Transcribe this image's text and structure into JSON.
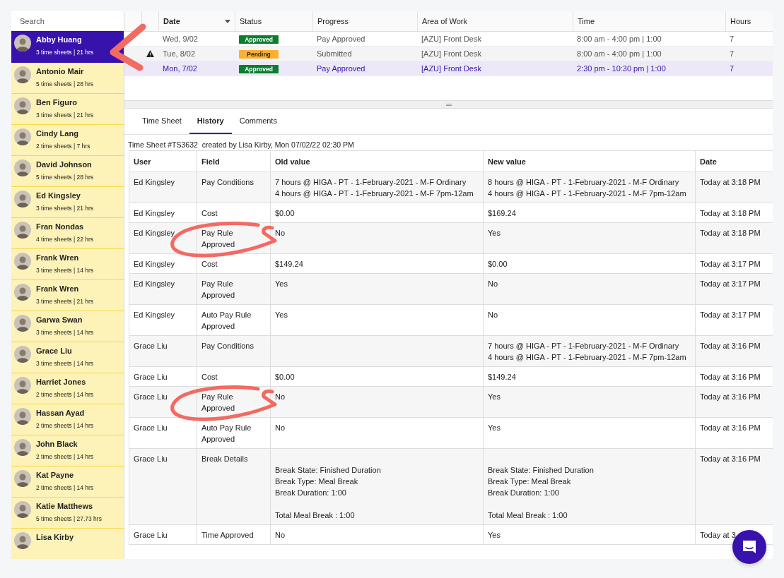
{
  "sidebar": {
    "search": {
      "placeholder": "Search"
    },
    "employees": [
      {
        "name": "Abby Huang",
        "summary": "3 time sheets | 21 hrs",
        "selected": true,
        "pointed_at": true
      },
      {
        "name": "Antonio Mair",
        "summary": "5 time sheets | 28 hrs",
        "selected": false,
        "pointed_at": false
      },
      {
        "name": "Ben Figuro",
        "summary": "3 time sheets | 21 hrs",
        "selected": false,
        "pointed_at": false
      },
      {
        "name": "Cindy Lang",
        "summary": "2 time sheets | 7 hrs",
        "selected": false,
        "pointed_at": false
      },
      {
        "name": "David Johnson",
        "summary": "5 time sheets | 28 hrs",
        "selected": false,
        "pointed_at": false
      },
      {
        "name": "Ed Kingsley",
        "summary": "3 time sheets | 21 hrs",
        "selected": false,
        "pointed_at": false
      },
      {
        "name": "Fran Nondas",
        "summary": "4 time sheets | 22 hrs",
        "selected": false,
        "pointed_at": false
      },
      {
        "name": "Frank Wren",
        "summary": "3 time sheets | 14 hrs",
        "selected": false,
        "pointed_at": false
      },
      {
        "name": "Frank Wren",
        "summary": "3 time sheets | 21 hrs",
        "selected": false,
        "pointed_at": false
      },
      {
        "name": "Garwa Swan",
        "summary": "3 time sheets | 14 hrs",
        "selected": false,
        "pointed_at": false
      },
      {
        "name": "Grace Liu",
        "summary": "3 time sheets | 14 hrs",
        "selected": false,
        "pointed_at": false
      },
      {
        "name": "Harriet Jones",
        "summary": "2 time sheets | 14 hrs",
        "selected": false,
        "pointed_at": false
      },
      {
        "name": "Hassan Ayad",
        "summary": "2 time sheets | 14 hrs",
        "selected": false,
        "pointed_at": false
      },
      {
        "name": "John Black",
        "summary": "2 time sheets | 14 hrs",
        "selected": false,
        "pointed_at": false
      },
      {
        "name": "Kat Payne",
        "summary": "2 time sheets | 14 hrs",
        "selected": false,
        "pointed_at": false
      },
      {
        "name": "Katie Matthews",
        "summary": "5 time sheets | 27.73 hrs",
        "selected": false,
        "pointed_at": false
      },
      {
        "name": "Lisa Kirby",
        "selected": false,
        "pointed_at": false
      }
    ]
  },
  "timesheets": {
    "columns": [
      {
        "label": "Date",
        "sorted": true
      },
      {
        "label": "Status",
        "sorted": false
      },
      {
        "label": "Progress",
        "sorted": false
      },
      {
        "label": "Area of Work",
        "sorted": false
      },
      {
        "label": "Time",
        "sorted": false
      },
      {
        "label": "Hours",
        "sorted": false
      }
    ],
    "rows": [
      {
        "selected": false,
        "warning": false,
        "date": "Wed, 9/02",
        "status": {
          "label": "Approved",
          "kind": "approved"
        },
        "progress": "Pay Approved",
        "area": "[AZU] Front Desk",
        "time": "8:00 am - 4:00 pm | 1:00",
        "hours": "7"
      },
      {
        "selected": false,
        "warning": true,
        "date": "Tue, 8/02",
        "status": {
          "label": "Pending",
          "kind": "pending"
        },
        "progress": "Submitted",
        "area": "[AZU] Front Desk",
        "time": "8:00 am - 4:00 pm | 1:00",
        "hours": "7"
      },
      {
        "selected": true,
        "warning": false,
        "date": "Mon, 7/02",
        "status": {
          "label": "Approved",
          "kind": "approved"
        },
        "progress": "Pay Approved",
        "area": "[AZU] Front Desk",
        "time": "2:30 pm - 10:30 pm | 1:00",
        "hours": "7"
      }
    ]
  },
  "tabs": [
    {
      "label": "Time Sheet",
      "selected": false
    },
    {
      "label": "History",
      "selected": true
    },
    {
      "label": "Comments",
      "selected": false
    }
  ],
  "history": {
    "caption": "Time Sheet #TS3632  created by Lisa Kirby, Mon 07/02/22 02:30 PM",
    "columns": [
      "User",
      "Field",
      "Old value",
      "New value",
      "Date"
    ],
    "rows": [
      {
        "user": "Ed Kingsley",
        "field": "Pay Conditions",
        "old_value": "7 hours @ HIGA - PT - 1-February-2021 - M-F Ordinary\n4 hours @ HIGA - PT - 1-February-2021 - M-F 7pm-12am",
        "new_value": "8 hours @ HIGA - PT - 1-February-2021 - M-F Ordinary\n4 hours @ HIGA - PT - 1-February-2021 - M-F 7pm-12am",
        "date": "Today at 3:18 PM",
        "circled": false
      },
      {
        "user": "Ed Kingsley",
        "field": "Cost",
        "old_value": "$0.00",
        "new_value": "$169.24",
        "date": "Today at 3:18 PM",
        "circled": false
      },
      {
        "user": "Ed Kingsley",
        "field": "Pay Rule Approved",
        "old_value": "No",
        "new_value": "Yes",
        "date": "Today at 3:18 PM",
        "circled": true
      },
      {
        "user": "Ed Kingsley",
        "field": "Cost",
        "old_value": "$149.24",
        "new_value": "$0.00",
        "date": "Today at 3:17 PM",
        "circled": false
      },
      {
        "user": "Ed Kingsley",
        "field": "Pay Rule Approved",
        "old_value": "Yes",
        "new_value": "No",
        "date": "Today at 3:17 PM",
        "circled": false
      },
      {
        "user": "Ed Kingsley",
        "field": "Auto Pay Rule Approved",
        "old_value": "Yes",
        "new_value": "No",
        "date": "Today at 3:17 PM",
        "circled": false
      },
      {
        "user": "Grace Liu",
        "field": "Pay Conditions",
        "new_value": "7 hours @ HIGA - PT - 1-February-2021 - M-F Ordinary\n4 hours @ HIGA - PT - 1-February-2021 - M-F 7pm-12am",
        "date": "Today at 3:16 PM",
        "circled": false
      },
      {
        "user": "Grace Liu",
        "field": "Cost",
        "old_value": "$0.00",
        "new_value": "$149.24",
        "date": "Today at 3:16 PM",
        "circled": false
      },
      {
        "user": "Grace Liu",
        "field": "Pay Rule Approved",
        "old_value": "No",
        "new_value": "Yes",
        "date": "Today at 3:16 PM",
        "circled": true
      },
      {
        "user": "Grace Liu",
        "field": "Auto Pay Rule Approved",
        "old_value": "No",
        "new_value": "Yes",
        "date": "Today at 3:16 PM",
        "circled": false
      },
      {
        "user": "Grace Liu",
        "field": "Break Details",
        "old_value": "\nBreak State: Finished Duration\nBreak Type: Meal Break\nBreak Duration: 1:00\n\nTotal Meal Break : 1:00",
        "new_value": "\nBreak State: Finished Duration\nBreak Type: Meal Break\nBreak Duration: 1:00\n\nTotal Meal Break : 1:00",
        "date": "Today at 3:16 PM",
        "circled": false
      },
      {
        "user": "Grace Liu",
        "field": "Time Approved",
        "old_value": "No",
        "new_value": "Yes",
        "date": "Today at 3",
        "circled": false
      }
    ]
  }
}
